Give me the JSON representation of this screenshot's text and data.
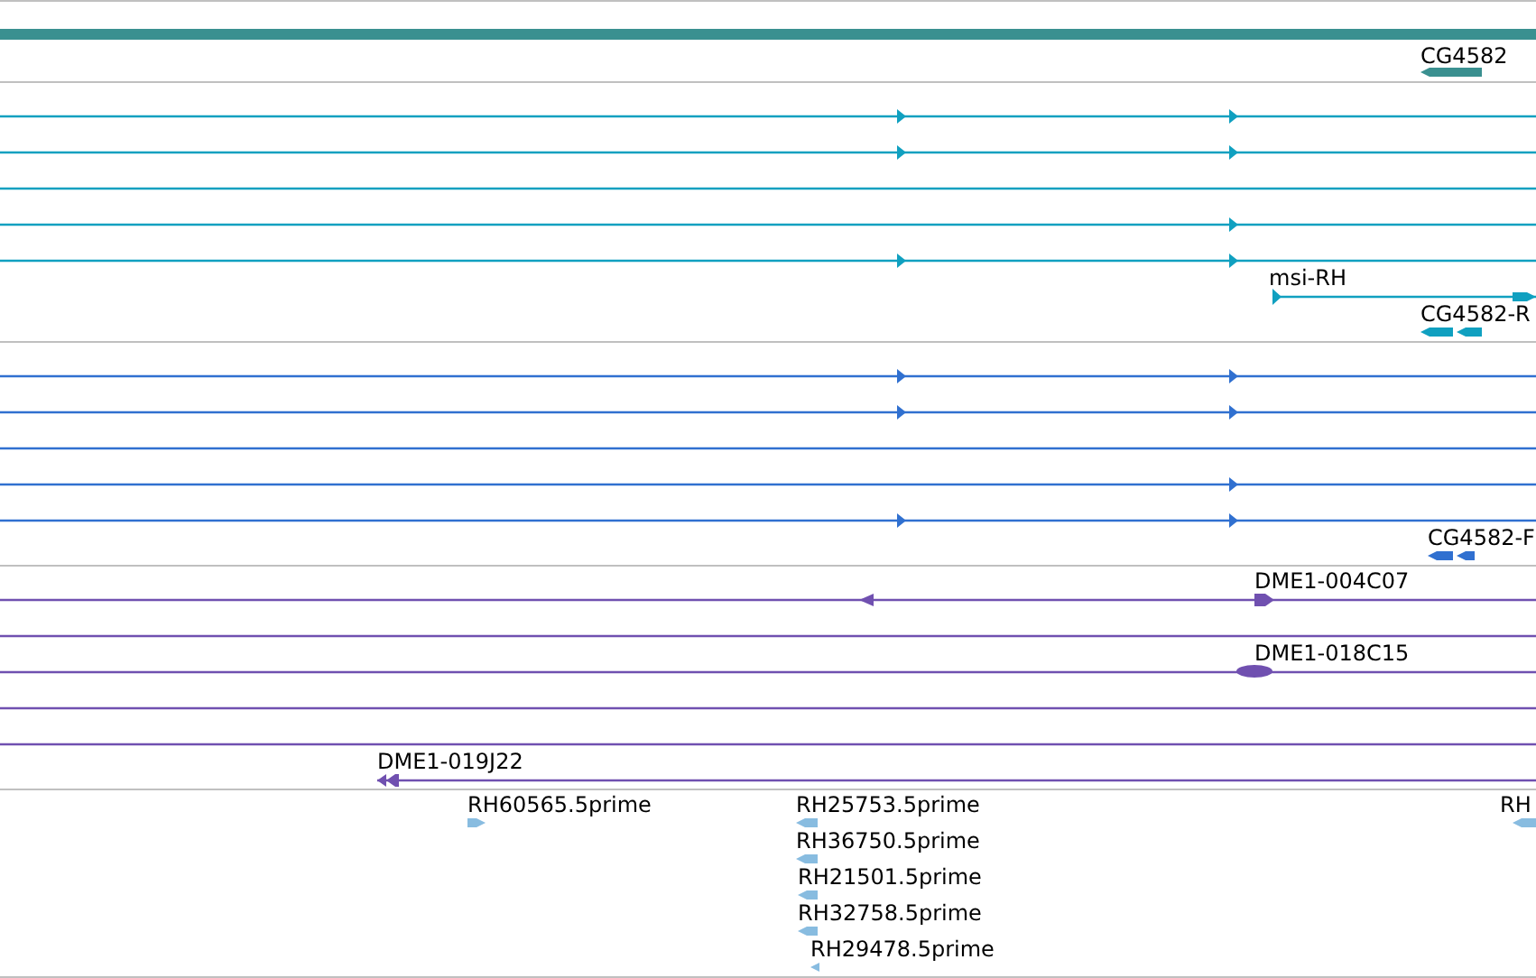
{
  "tracks": [
    {
      "color": "#3a9090",
      "features": [
        {
          "label": "CG4582"
        }
      ]
    },
    {
      "color": "#10a0c0",
      "features": [
        {
          "label": "msi-RH"
        },
        {
          "label": "CG4582-R"
        }
      ]
    },
    {
      "color": "#3070d0",
      "features": [
        {
          "label": "CG4582-F"
        }
      ]
    },
    {
      "color": "#7050b0",
      "features": [
        {
          "label": "DME1-004C07"
        },
        {
          "label": "DME1-018C15"
        },
        {
          "label": "DME1-019J22"
        }
      ]
    },
    {
      "color": "#88bce0",
      "features": [
        {
          "label": "RH60565.5prime"
        },
        {
          "label": "RH25753.5prime"
        },
        {
          "label": "RH36750.5prime"
        },
        {
          "label": "RH21501.5prime"
        },
        {
          "label": "RH32758.5prime"
        },
        {
          "label": "RH29478.5prime"
        },
        {
          "label": "RH"
        }
      ]
    }
  ]
}
